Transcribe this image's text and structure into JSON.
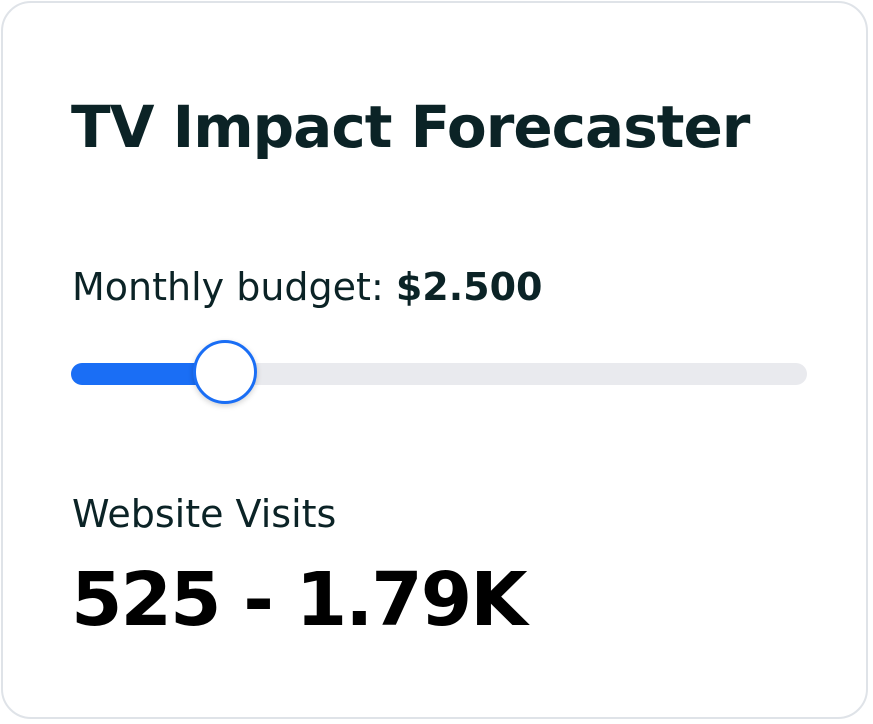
{
  "title": "TV Impact Forecaster",
  "budget": {
    "label": "Monthly budget:",
    "value": "$2.500",
    "slider_fraction": 0.21
  },
  "metric": {
    "label": "Website Visits",
    "value": "525 - 1.79K"
  },
  "colors": {
    "accent": "#1a6ef5",
    "track": "#e9eaee",
    "text": "#0b2326",
    "border": "#dfe3e8"
  }
}
